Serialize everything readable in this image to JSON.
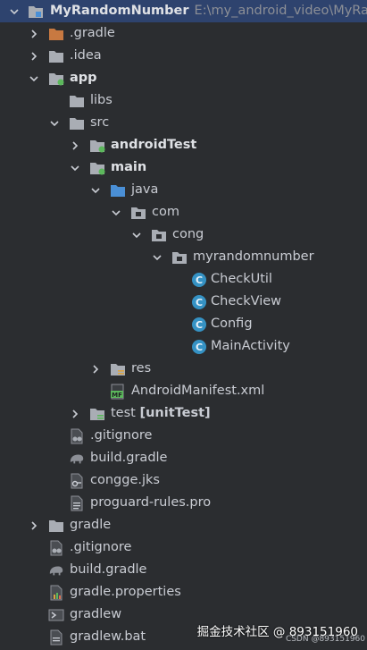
{
  "project": {
    "name": "MyRandomNumber",
    "path": "E:\\my_android_video\\MyRa"
  },
  "tree": {
    "gradle_dot": ".gradle",
    "idea": ".idea",
    "app": "app",
    "libs": "libs",
    "src": "src",
    "android_test": "androidTest",
    "main": "main",
    "java": "java",
    "com": "com",
    "cong": "cong",
    "myrandomnumber": "myrandomnumber",
    "check_util": "CheckUtil",
    "check_view": "CheckView",
    "config": "Config",
    "main_activity": "MainActivity",
    "res": "res",
    "manifest": "AndroidManifest.xml",
    "test": "test",
    "unit_test": "[unitTest]",
    "app_gitignore": ".gitignore",
    "app_build_gradle": "build.gradle",
    "congge_jks": "congge.jks",
    "proguard": "proguard-rules.pro",
    "gradle": "gradle",
    "root_gitignore": ".gitignore",
    "root_build_gradle": "build.gradle",
    "gradle_properties": "gradle.properties",
    "gradlew": "gradlew",
    "gradlew_bat": "gradlew.bat"
  },
  "watermark": {
    "text": "掘金技术社区 @ 893151960",
    "csdn": "CSDN @893151960"
  },
  "colors": {
    "selected_row": "#2e436e",
    "folder": "#a9adb4",
    "orange_folder": "#c87941",
    "java_folder": "#4a8fd6",
    "class_icon": "#3592c4",
    "module_dot": "#5cb85c"
  }
}
